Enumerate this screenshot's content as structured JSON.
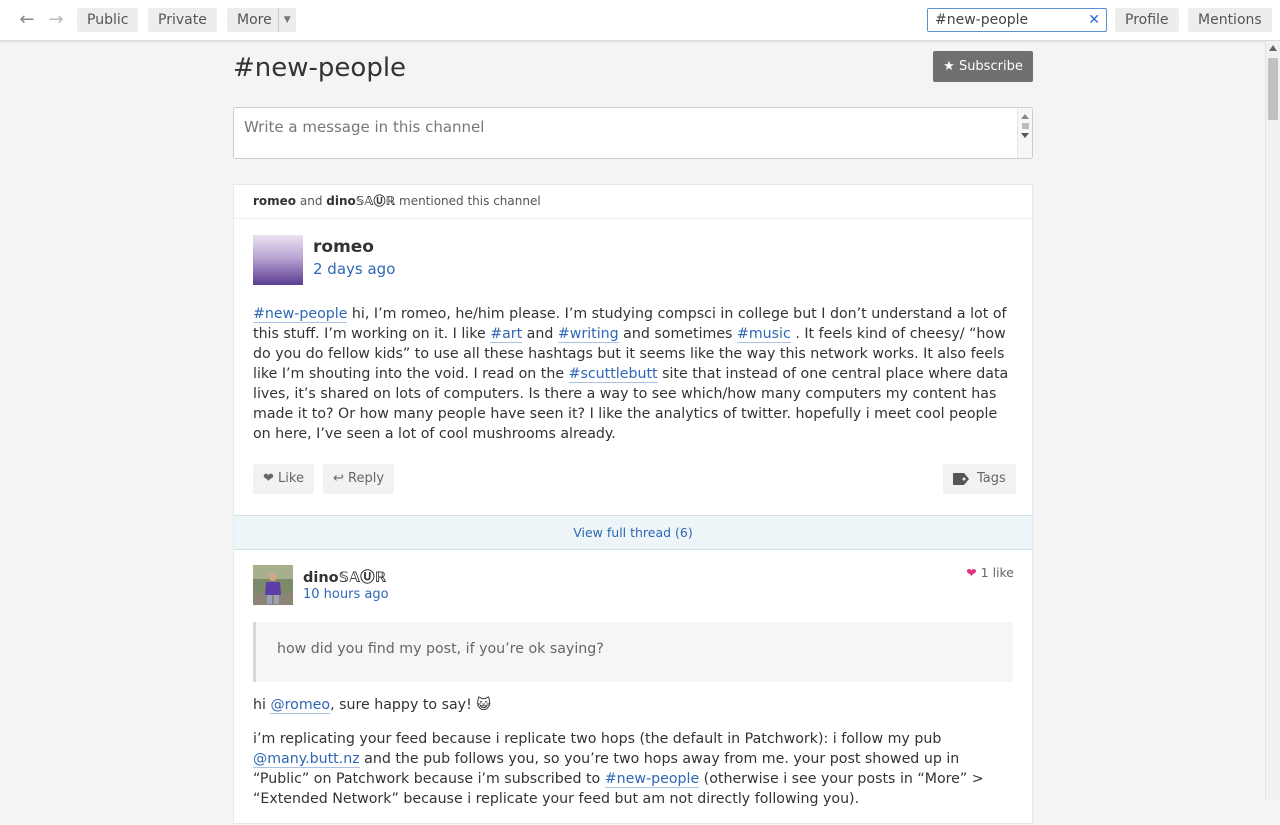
{
  "topbar": {
    "tabs": {
      "public": "Public",
      "private": "Private",
      "more": "More",
      "profile": "Profile",
      "mentions": "Mentions"
    },
    "search_value": "#new-people"
  },
  "channel": {
    "title": "#new-people",
    "subscribe_label": "★ Subscribe",
    "compose_placeholder": "Write a message in this channel"
  },
  "card": {
    "mention_user1": "romeo",
    "mention_and": "and",
    "mention_user2": "dino𝕊𝔸Ⓤℝ",
    "mention_suffix": "mentioned this channel"
  },
  "post1": {
    "author": "romeo",
    "time": "2 days ago",
    "tag1": "#new-people",
    "text1": " hi, I’m romeo, he/him please. I’m studying compsci in college but I don’t understand a lot of this stuff. I’m working on it. I like ",
    "tag2": "#art",
    "text2": " and ",
    "tag3": "#writing",
    "text3": " and sometimes ",
    "tag4": "#music",
    "text4": " . It feels kind of cheesy/ “how do you do fellow kids” to use all these hashtags but it seems like the way this network works. It also feels like I’m shouting into the void. I read on the ",
    "tag5": "#scuttlebutt",
    "text5": " site that instead of one central place where data lives, it’s shared on lots of computers. Is there a way to see which/how many computers my content has made it to? Or how many people have seen it? I like the analytics of twitter. hopefully i meet cool people on here, I’ve seen a lot of cool mushrooms already.",
    "like_label": "❤ Like",
    "reply_label": "↩ Reply",
    "tags_label": "Tags"
  },
  "thread_link": "View full thread (6)",
  "post2": {
    "author": "dino𝕊𝔸Ⓤℝ",
    "time": "10 hours ago",
    "likes": "1 like",
    "heart": "❤",
    "quote": "how did you find my post, if you’re ok saying?",
    "p1_prefix": "hi ",
    "p1_mention": "@romeo",
    "p1_suffix": ", sure happy to say! 😺",
    "p2_text1": "i’m replicating your feed because i replicate two hops (the default in Patchwork): i follow my pub ",
    "p2_mention": "@many.butt.nz",
    "p2_text2": " and the pub follows you, so you’re two hops away from me. your post showed up in “Public” on Patchwork because i’m subscribed to ",
    "p2_tag": "#new-people",
    "p2_text3": " (otherwise i see your posts in “More” > “Extended Network” because i replicate your feed but am not directly following you)."
  }
}
